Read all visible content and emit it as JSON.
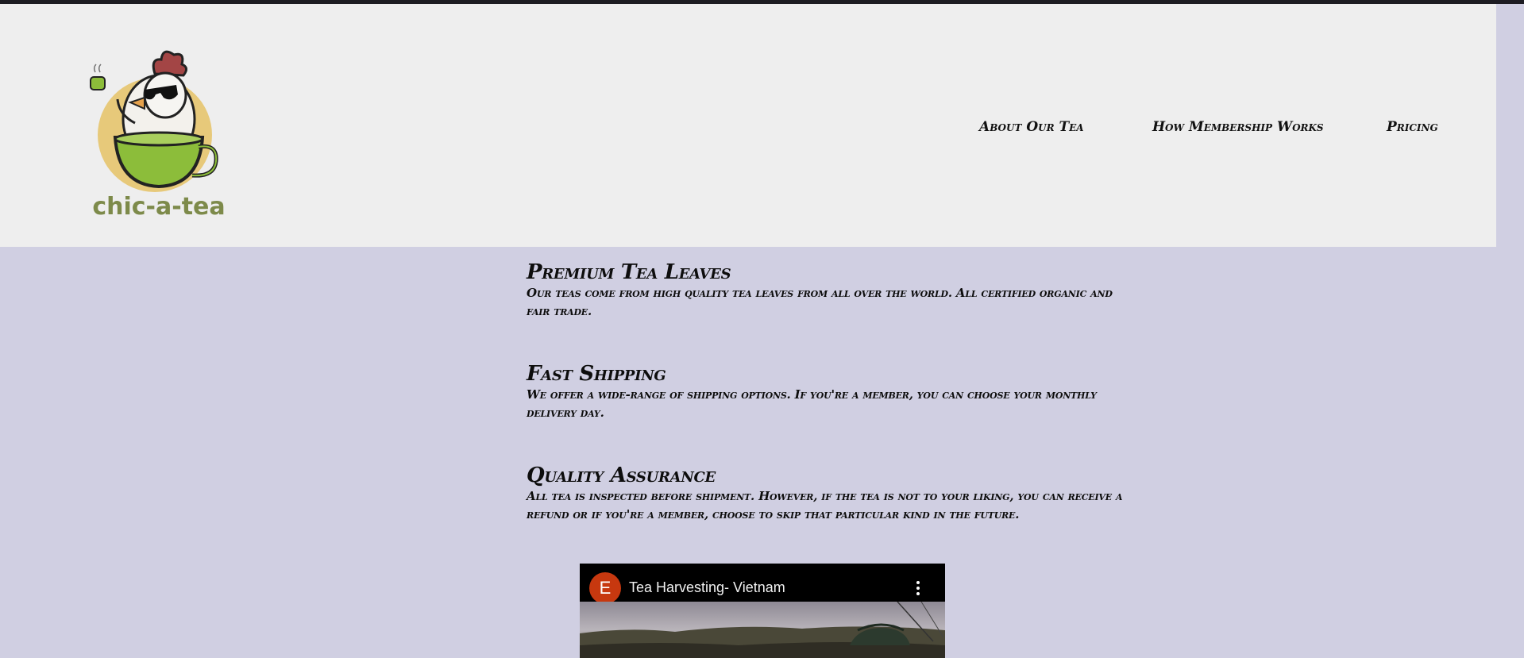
{
  "brand": {
    "name": "chic-a-tea",
    "colors": {
      "header_bg": "#eeeeee",
      "page_bg": "#d0cfe2",
      "logo_text": "#7d8a4a",
      "cup_green": "#8cbd3a"
    }
  },
  "nav": {
    "items": [
      {
        "label": "About Our Tea"
      },
      {
        "label": "How Membership Works"
      },
      {
        "label": "Pricing"
      }
    ]
  },
  "features": [
    {
      "title": "Premium Tea Leaves",
      "text": "Our teas come from high quality tea leaves from all over the world. All certified organic and fair trade."
    },
    {
      "title": "Fast Shipping",
      "text": "We offer a wide-range of shipping options. If you're a member, you can choose your monthly delivery day."
    },
    {
      "title": "Quality Assurance",
      "text": "All tea is inspected before shipment. However, if the tea is not to your liking, you can receive a refund or if you're a member, choose to skip that particular kind in the future."
    }
  ],
  "video": {
    "channel_initial": "E",
    "title": "Tea Harvesting- Vietnam",
    "avatar_color": "#c7380f",
    "menu_icon": "kebab-menu-icon"
  }
}
